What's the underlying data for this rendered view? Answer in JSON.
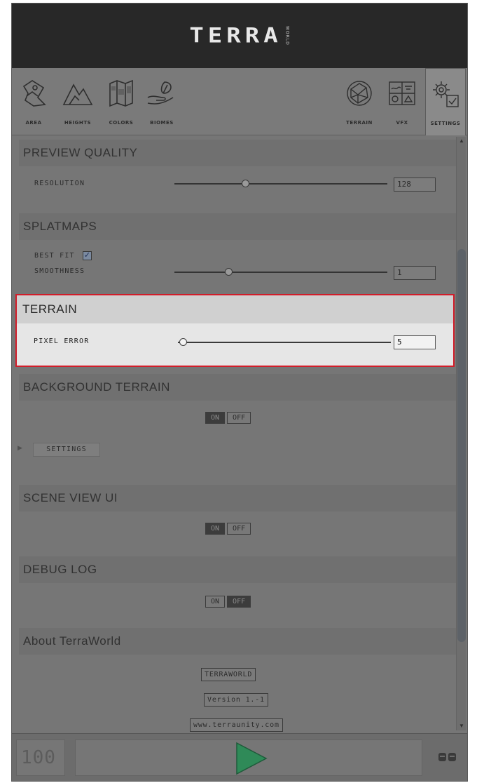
{
  "app": {
    "logo_text": "TERRA",
    "logo_sub": "WORLD"
  },
  "toolbar": {
    "left_tools": [
      {
        "label": "AREA",
        "icon": "area-map-icon"
      },
      {
        "label": "HEIGHTS",
        "icon": "mountain-icon"
      },
      {
        "label": "COLORS",
        "icon": "texture-map-icon"
      },
      {
        "label": "BIOMES",
        "icon": "leaf-hand-icon"
      }
    ],
    "right_tools": [
      {
        "label": "TERRAIN",
        "icon": "terrain-globe-icon"
      },
      {
        "label": "VFX",
        "icon": "vfx-icon"
      },
      {
        "label": "SETTINGS",
        "icon": "settings-gear-icon",
        "active": true
      }
    ]
  },
  "sections": {
    "preview_quality": {
      "title": "PREVIEW QUALITY",
      "resolution_label": "RESOLUTION",
      "resolution_value": "128",
      "resolution_slider_level": 0.33
    },
    "splatmaps": {
      "title": "SPLATMAPS",
      "best_fit_label": "BEST FIT",
      "best_fit_checked": true,
      "best_fit_check_glyph": "✓",
      "smoothness_label": "SMOOTHNESS",
      "smoothness_value": "1",
      "smoothness_slider_level": 0.26
    },
    "terrain": {
      "title": "TERRAIN",
      "pixel_error_label": "PIXEL ERROR",
      "pixel_error_value": "5",
      "pixel_error_slider_level": 0.04
    },
    "background_terrain": {
      "title": "BACKGROUND TERRAIN",
      "on_label": "ON",
      "off_label": "OFF",
      "state": "ON",
      "settings_label": "SETTINGS"
    },
    "scene_view_ui": {
      "title": "SCENE VIEW UI",
      "on_label": "ON",
      "off_label": "OFF",
      "state": "ON"
    },
    "debug_log": {
      "title": "DEBUG LOG",
      "on_label": "ON",
      "off_label": "OFF",
      "state": "OFF"
    },
    "about": {
      "title": "About TerraWorld",
      "name_button": "TERRAWORLD",
      "version_button": "Version 1.-1",
      "website_button": "www.terraunity.com"
    }
  },
  "footer": {
    "counter_text": "100"
  },
  "colors": {
    "highlight_border": "#d21d2a",
    "header_bg": "#282828",
    "play_triangle": "#2f8a58"
  }
}
